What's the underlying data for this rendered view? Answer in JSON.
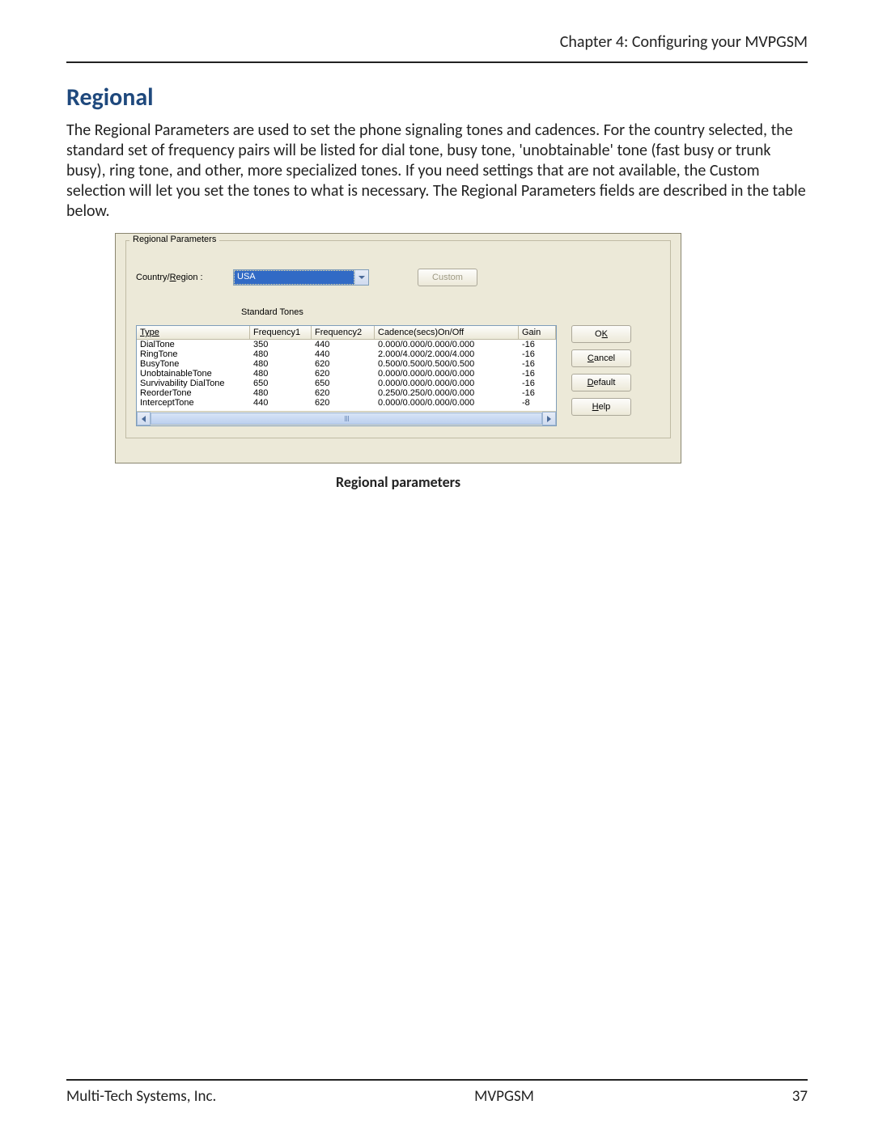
{
  "header": {
    "chapter": "Chapter 4: Configuring your MVPGSM"
  },
  "section": {
    "title": "Regional",
    "paragraph": "The Regional Parameters are used to set the phone signaling tones and cadences. For the country selected, the standard set of frequency pairs will be listed for dial tone, busy tone, 'unobtainable' tone (fast busy or trunk busy), ring tone, and other, more specialized tones. If you need settings that are not available, the Custom selection will let you set the tones to what is necessary. The Regional Parameters fields are described in the table below."
  },
  "dialog": {
    "group_title": "Regional Parameters",
    "country_label_pre": "Country/",
    "country_label_u": "R",
    "country_label_post": "egion :",
    "country_value": "USA",
    "custom_btn": "Custom",
    "subheading": "Standard Tones",
    "columns": {
      "type": "Type",
      "f1": "Frequency1",
      "f2": "Frequency2",
      "cad": "Cadence(secs)On/Off",
      "gain": "Gain"
    },
    "col_widths": {
      "type": 140,
      "f1": 76,
      "f2": 78,
      "cad": 178,
      "gain": 46
    },
    "rows": [
      {
        "type": "DialTone",
        "f1": "350",
        "f2": "440",
        "cad": "0.000/0.000/0.000/0.000",
        "gain": "-16"
      },
      {
        "type": "RingTone",
        "f1": "480",
        "f2": "440",
        "cad": "2.000/4.000/2.000/4.000",
        "gain": "-16"
      },
      {
        "type": "BusyTone",
        "f1": "480",
        "f2": "620",
        "cad": "0.500/0.500/0.500/0.500",
        "gain": "-16"
      },
      {
        "type": "UnobtainableTone",
        "f1": "480",
        "f2": "620",
        "cad": "0.000/0.000/0.000/0.000",
        "gain": "-16"
      },
      {
        "type": "Survivability DialTone",
        "f1": "650",
        "f2": "650",
        "cad": "0.000/0.000/0.000/0.000",
        "gain": "-16"
      },
      {
        "type": "ReorderTone",
        "f1": "480",
        "f2": "620",
        "cad": "0.250/0.250/0.000/0.000",
        "gain": "-16"
      },
      {
        "type": "InterceptTone",
        "f1": "440",
        "f2": "620",
        "cad": "0.000/0.000/0.000/0.000",
        "gain": "-8"
      }
    ],
    "buttons": {
      "ok_u": "K",
      "ok_pre": "O",
      "ok_post": "",
      "cancel_u": "C",
      "cancel_post": "ancel",
      "default_u": "D",
      "default_post": "efault",
      "help_u": "H",
      "help_post": "elp"
    }
  },
  "caption": "Regional parameters",
  "footer": {
    "left": "Multi-Tech Systems, Inc.",
    "center": "MVPGSM",
    "right": "37"
  },
  "colors": {
    "heading": "#1f497d",
    "panel": "#ece9d8",
    "sel_bg": "#316ac5"
  }
}
